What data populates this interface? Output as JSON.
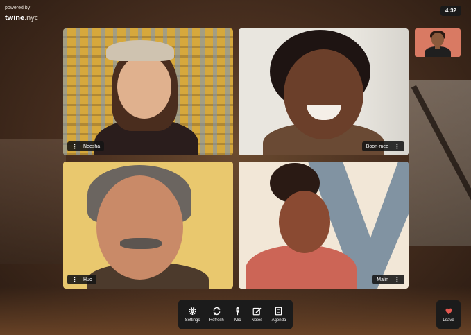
{
  "brand": {
    "powered_by": "powered by",
    "name": "twine",
    "domain": ".nyc"
  },
  "timer": "4:32",
  "participants": [
    {
      "name": "Neesha"
    },
    {
      "name": "Boon-mee"
    },
    {
      "name": "Huo"
    },
    {
      "name": "Malin"
    }
  ],
  "toolbar": {
    "settings": "Settings",
    "refresh": "Refresh",
    "mic": "Mic",
    "notes": "Notes",
    "agenda": "Agenda"
  },
  "leave": "Leave",
  "menu_glyph": "⋮",
  "icons": {
    "settings": "gear-icon",
    "refresh": "refresh-icon",
    "mic": "mic-icon",
    "notes": "notes-icon",
    "agenda": "agenda-icon",
    "leave": "leave-icon"
  },
  "colors": {
    "toolbar_bg": "#1b1b1b",
    "leave_accent": "#e4574f",
    "self_view_bg": "#d97a63"
  }
}
